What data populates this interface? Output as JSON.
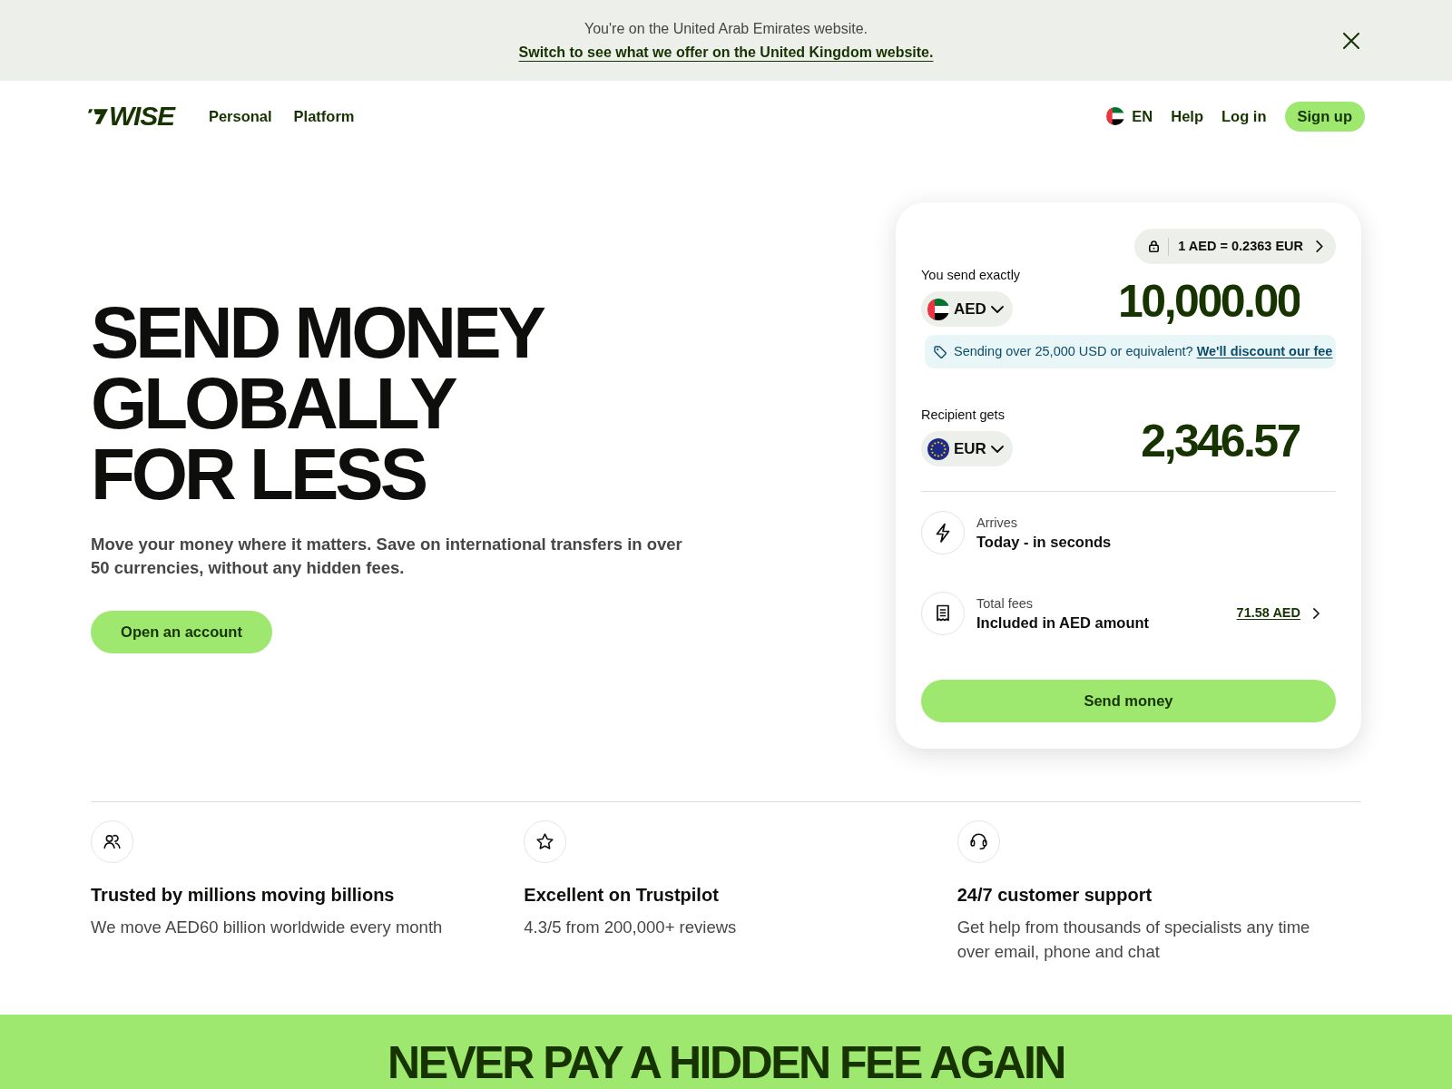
{
  "banner": {
    "message": "You're on the United Arab Emirates website.",
    "link": "Switch to see what we offer on the United Kingdom website."
  },
  "nav": {
    "logo": "WISE",
    "links": [
      "Personal",
      "Platform"
    ],
    "language": "EN",
    "actions": [
      "Help",
      "Log in"
    ],
    "signup": "Sign up"
  },
  "hero": {
    "title": "SEND MONEY GLOBALLY FOR LESS",
    "subtitle": "Move your money where it matters. Save on international transfers in over 50 currencies, without any hidden fees.",
    "button": "Open an account"
  },
  "calculator": {
    "rate": "1 AED = 0.2363 EUR",
    "send": {
      "label": "You send exactly",
      "currency": "AED",
      "amount": "10,000.00"
    },
    "discount": {
      "text": "Sending over 25,000 USD or equivalent?",
      "link": "We'll discount our fee"
    },
    "receive": {
      "label": "Recipient gets",
      "currency": "EUR",
      "amount": "2,346.57"
    },
    "details": [
      {
        "kind": "arrival",
        "label": "Arrives",
        "value": "Today - in seconds"
      },
      {
        "kind": "fees",
        "label": "Total fees",
        "value": "Included in AED amount",
        "amount": "71.58 AED"
      }
    ],
    "button": "Send money"
  },
  "features": [
    {
      "title": "Trusted by millions moving billions",
      "description": "We move AED60 billion worldwide every month"
    },
    {
      "title": "Excellent on Trustpilot",
      "description": "4.3/5 from 200,000+ reviews"
    },
    {
      "title": "24/7 customer support",
      "description": "Get help from thousands of specialists any time over email, phone and chat"
    }
  ],
  "promo": {
    "heading": "NEVER PAY A HIDDEN FEE AGAIN"
  }
}
